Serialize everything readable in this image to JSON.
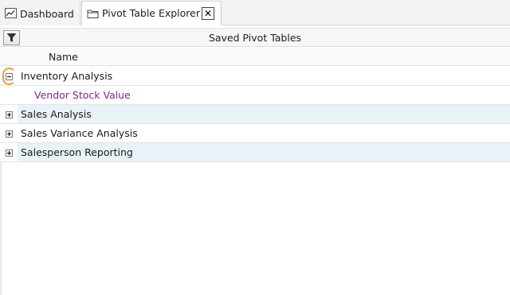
{
  "tabs": [
    {
      "label": "Dashboard",
      "icon": "chart-icon",
      "active": false
    },
    {
      "label": "Pivot Table Explorer",
      "icon": "folder-icon",
      "active": true
    }
  ],
  "header": {
    "title": "Saved Pivot Tables",
    "filter_icon": "filter-icon"
  },
  "columns": {
    "name": "Name"
  },
  "tree": [
    {
      "label": "Inventory Analysis",
      "expanded": true
    },
    {
      "label": "Vendor Stock Value"
    },
    {
      "label": "Sales Analysis",
      "expanded": false
    },
    {
      "label": "Sales Variance Analysis",
      "expanded": false
    },
    {
      "label": "Salesperson Reporting",
      "expanded": false
    }
  ],
  "colors": {
    "child_text": "#7a2a8a",
    "alt_row": "#e9f2f6",
    "focus_ring": "#f0a030"
  }
}
